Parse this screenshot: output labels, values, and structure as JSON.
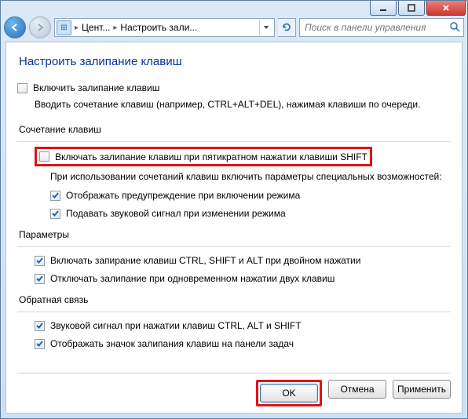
{
  "titlebar": {},
  "nav": {
    "crumb1": "Цент...",
    "crumb2": "Настроить зали...",
    "search_placeholder": "Поиск в панели управления"
  },
  "page": {
    "heading": "Настроить залипание клавиш",
    "enable_label": "Включить залипание клавиш",
    "enable_desc": "Вводить сочетание клавиш (например, CTRL+ALT+DEL), нажимая клавиши по очереди.",
    "group_shortcut": "Сочетание клавиш",
    "shift5_label": "Включать залипание клавиш при пятикратном нажатии клавиши SHIFT",
    "shift5_desc": "При использовании сочетаний клавиш включить параметры специальных возможностей:",
    "warn_label": "Отображать предупреждение при включении режима",
    "sound_label": "Подавать звуковой сигнал при изменении режима",
    "group_params": "Параметры",
    "lock_label": "Включать запирание клавиш CTRL, SHIFT и ALT при двойном нажатии",
    "off_label": "Отключать залипание при одновременном нажатии двух клавиш",
    "group_feedback": "Обратная связь",
    "beep_label": "Звуковой сигнал при нажатии клавиш CTRL, ALT и SHIFT",
    "tray_label": "Отображать значок залипания клавиш на панели задач"
  },
  "buttons": {
    "ok": "OK",
    "cancel": "Отмена",
    "apply": "Применить"
  }
}
